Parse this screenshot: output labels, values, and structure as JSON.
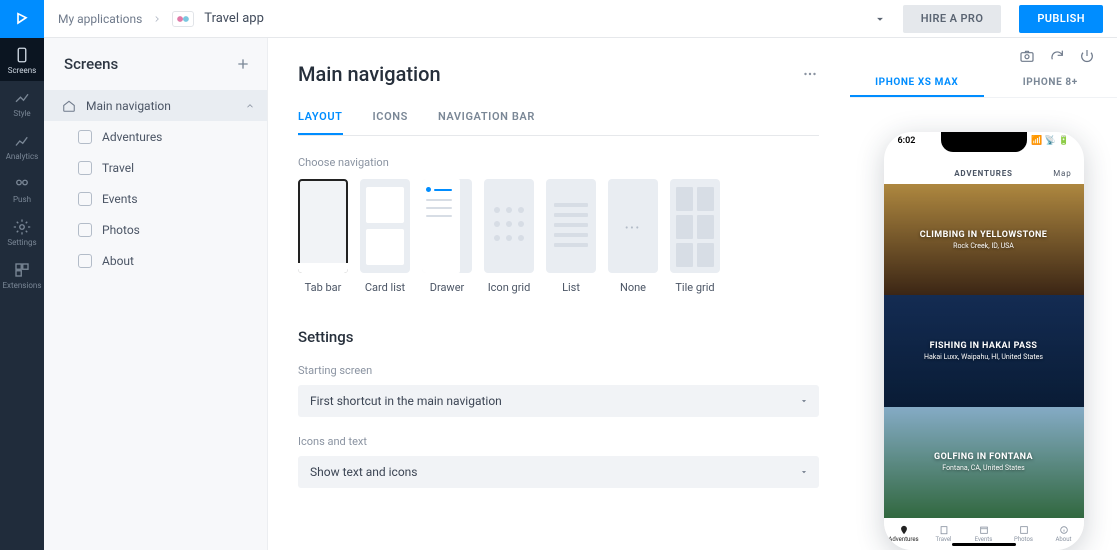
{
  "rail": {
    "items": [
      {
        "label": "Screens",
        "active": true
      },
      {
        "label": "Style"
      },
      {
        "label": "Analytics"
      },
      {
        "label": "Push"
      },
      {
        "label": "Settings"
      },
      {
        "label": "Extensions"
      }
    ]
  },
  "breadcrumb": {
    "root": "My applications",
    "app": "Travel app"
  },
  "header": {
    "hire": "HIRE A PRO",
    "publish": "PUBLISH"
  },
  "screens": {
    "title": "Screens",
    "parent": "Main navigation",
    "children": [
      "Adventures",
      "Travel",
      "Events",
      "Photos",
      "About"
    ]
  },
  "main": {
    "title": "Main navigation",
    "tabs": [
      "LAYOUT",
      "ICONS",
      "NAVIGATION BAR"
    ],
    "choose_label": "Choose navigation",
    "navOptions": [
      "Tab bar",
      "Card list",
      "Drawer",
      "Icon grid",
      "List",
      "None",
      "Tile grid"
    ],
    "settings_heading": "Settings",
    "starting_label": "Starting screen",
    "starting_value": "First shortcut in the main navigation",
    "icons_label": "Icons and text",
    "icons_value": "Show text and icons"
  },
  "preview": {
    "devices": [
      "IPHONE XS MAX",
      "IPHONE 8+"
    ],
    "time": "6:02",
    "screen_title": "ADVENTURES",
    "map": "Map",
    "cards": [
      {
        "title": "CLIMBING IN YELLOWSTONE",
        "subtitle": "Rock Creek, ID, USA"
      },
      {
        "title": "FISHING IN HAKAI PASS",
        "subtitle": "Hakai Luxx, Waipahu, HI, United States"
      },
      {
        "title": "GOLFING IN FONTANA",
        "subtitle": "Fontana, CA, United States"
      }
    ],
    "nav": [
      "Adventures",
      "Travel",
      "Events",
      "Photos",
      "About"
    ]
  }
}
